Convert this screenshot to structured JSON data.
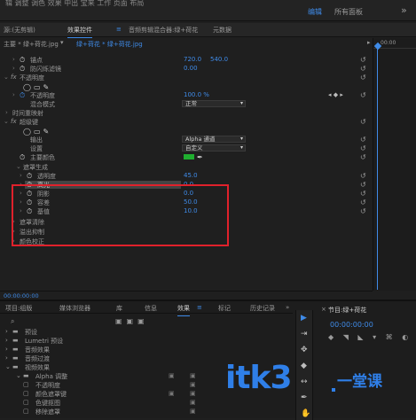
{
  "topbar": {
    "garbled": "辑 调整 调色 效果 中出 宝来 工作 页面 布局",
    "ws_edit": "编辑",
    "ws_all": "所有面板",
    "menu_icon": "hamburger-icon"
  },
  "tabs": [
    "源:(无剪辑)",
    "效果控件",
    "音频剪辑混合器:绿+荷花",
    "元数据"
  ],
  "clipbar": {
    "left": "主要 * 绿+荷花.jpg",
    "right": "绿+荷花 * 绿+荷花.jpg"
  },
  "timeline": {
    "time": "00:00"
  },
  "rows": {
    "anchor": {
      "label": "锚点",
      "v1": "720.0",
      "v2": "540.0"
    },
    "anti": {
      "label": "防闪烁滤镜",
      "val": "0.00"
    },
    "opacity": {
      "label": "不透明度",
      "fx": "fx"
    },
    "opacity_val": {
      "label": "不透明度",
      "val": "100.0 %"
    },
    "blend": {
      "label": "混合模式",
      "val": "正常"
    },
    "time_remap": {
      "label": "时间重映射"
    },
    "ultra": {
      "label": "超级键",
      "fx": "fx"
    },
    "output": {
      "label": "输出",
      "val": "Alpha 通道"
    },
    "setting": {
      "label": "设置",
      "val": "自定义"
    },
    "key_color": {
      "label": "主要颜色",
      "color": "#1fae2f"
    },
    "matte_gen": {
      "label": "遮罩生成"
    },
    "transparency": {
      "label": "透明度",
      "val": "45.0"
    },
    "highlight": {
      "label": "高光",
      "val": "0.0"
    },
    "shadow": {
      "label": "阴影",
      "val": "0.0"
    },
    "tolerance": {
      "label": "容差",
      "val": "50.0"
    },
    "pedestal": {
      "label": "基值",
      "val": "10.0"
    },
    "matte_clean": {
      "label": "遮罩清除"
    },
    "spill": {
      "label": "溢出抑制"
    },
    "color_corr": {
      "label": "颜色校正"
    }
  },
  "timecode": "00:00:00:00",
  "bottom": {
    "tabs": [
      "项目:组版",
      "媒体浏览器",
      "库",
      "信息",
      "效果",
      "标记",
      "历史记录"
    ],
    "tree": [
      "预设",
      "Lumetri 预设",
      "音频效果",
      "音频过渡",
      "视频效果",
      "Alpha 调整",
      "不透明度",
      "颜色遮罩键",
      "色键抠图",
      "移除遮罩"
    ],
    "program": {
      "title": "节目:绿+荷花",
      "timecode": "00:00:00:00"
    }
  },
  "watermark": {
    "text": "itk3",
    "cn": "一堂课"
  }
}
